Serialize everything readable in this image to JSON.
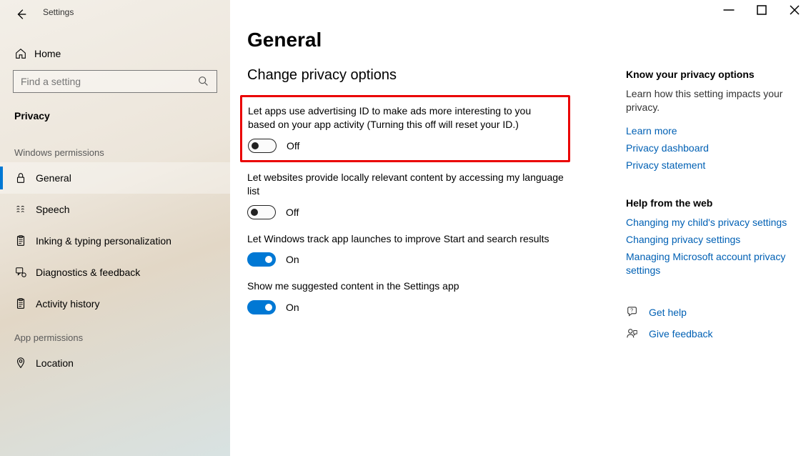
{
  "window": {
    "title": "Settings"
  },
  "sidebar": {
    "home_label": "Home",
    "search_placeholder": "Find a setting",
    "privacy_label": "Privacy",
    "groups": [
      {
        "id": "win-perm",
        "label": "Windows permissions",
        "items": [
          {
            "key": "general",
            "label": "General",
            "icon": "lock-icon",
            "active": true
          },
          {
            "key": "speech",
            "label": "Speech",
            "icon": "speech-icon",
            "active": false
          },
          {
            "key": "inking",
            "label": "Inking & typing personalization",
            "icon": "clipboard-icon",
            "active": false
          },
          {
            "key": "diagnostics",
            "label": "Diagnostics & feedback",
            "icon": "feedback-icon",
            "active": false
          },
          {
            "key": "activity",
            "label": "Activity history",
            "icon": "clipboard-icon",
            "active": false
          }
        ]
      },
      {
        "id": "app-perm",
        "label": "App permissions",
        "items": [
          {
            "key": "location",
            "label": "Location",
            "icon": "location-icon",
            "active": false
          }
        ]
      }
    ]
  },
  "page": {
    "title": "General",
    "section_title": "Change privacy options",
    "settings": [
      {
        "key": "advertising-id",
        "highlighted": true,
        "desc": "Let apps use advertising ID to make ads more interesting to you based on your app activity (Turning this off will reset your ID.)",
        "state": "Off",
        "on": false
      },
      {
        "key": "language-list",
        "highlighted": false,
        "desc": "Let websites provide locally relevant content by accessing my language list",
        "state": "Off",
        "on": false
      },
      {
        "key": "track-launches",
        "highlighted": false,
        "desc": "Let Windows track app launches to improve Start and search results",
        "state": "On",
        "on": true
      },
      {
        "key": "suggested-content",
        "highlighted": false,
        "desc": "Show me suggested content in the Settings app",
        "state": "On",
        "on": true
      }
    ]
  },
  "right": {
    "know_title": "Know your privacy options",
    "know_sub": "Learn how this setting impacts your privacy.",
    "know_links": [
      "Learn more",
      "Privacy dashboard",
      "Privacy statement"
    ],
    "help_title": "Help from the web",
    "help_links": [
      "Changing my child's privacy settings",
      "Changing privacy settings",
      "Managing Microsoft account privacy settings"
    ],
    "get_help_label": "Get help",
    "give_feedback_label": "Give feedback"
  }
}
